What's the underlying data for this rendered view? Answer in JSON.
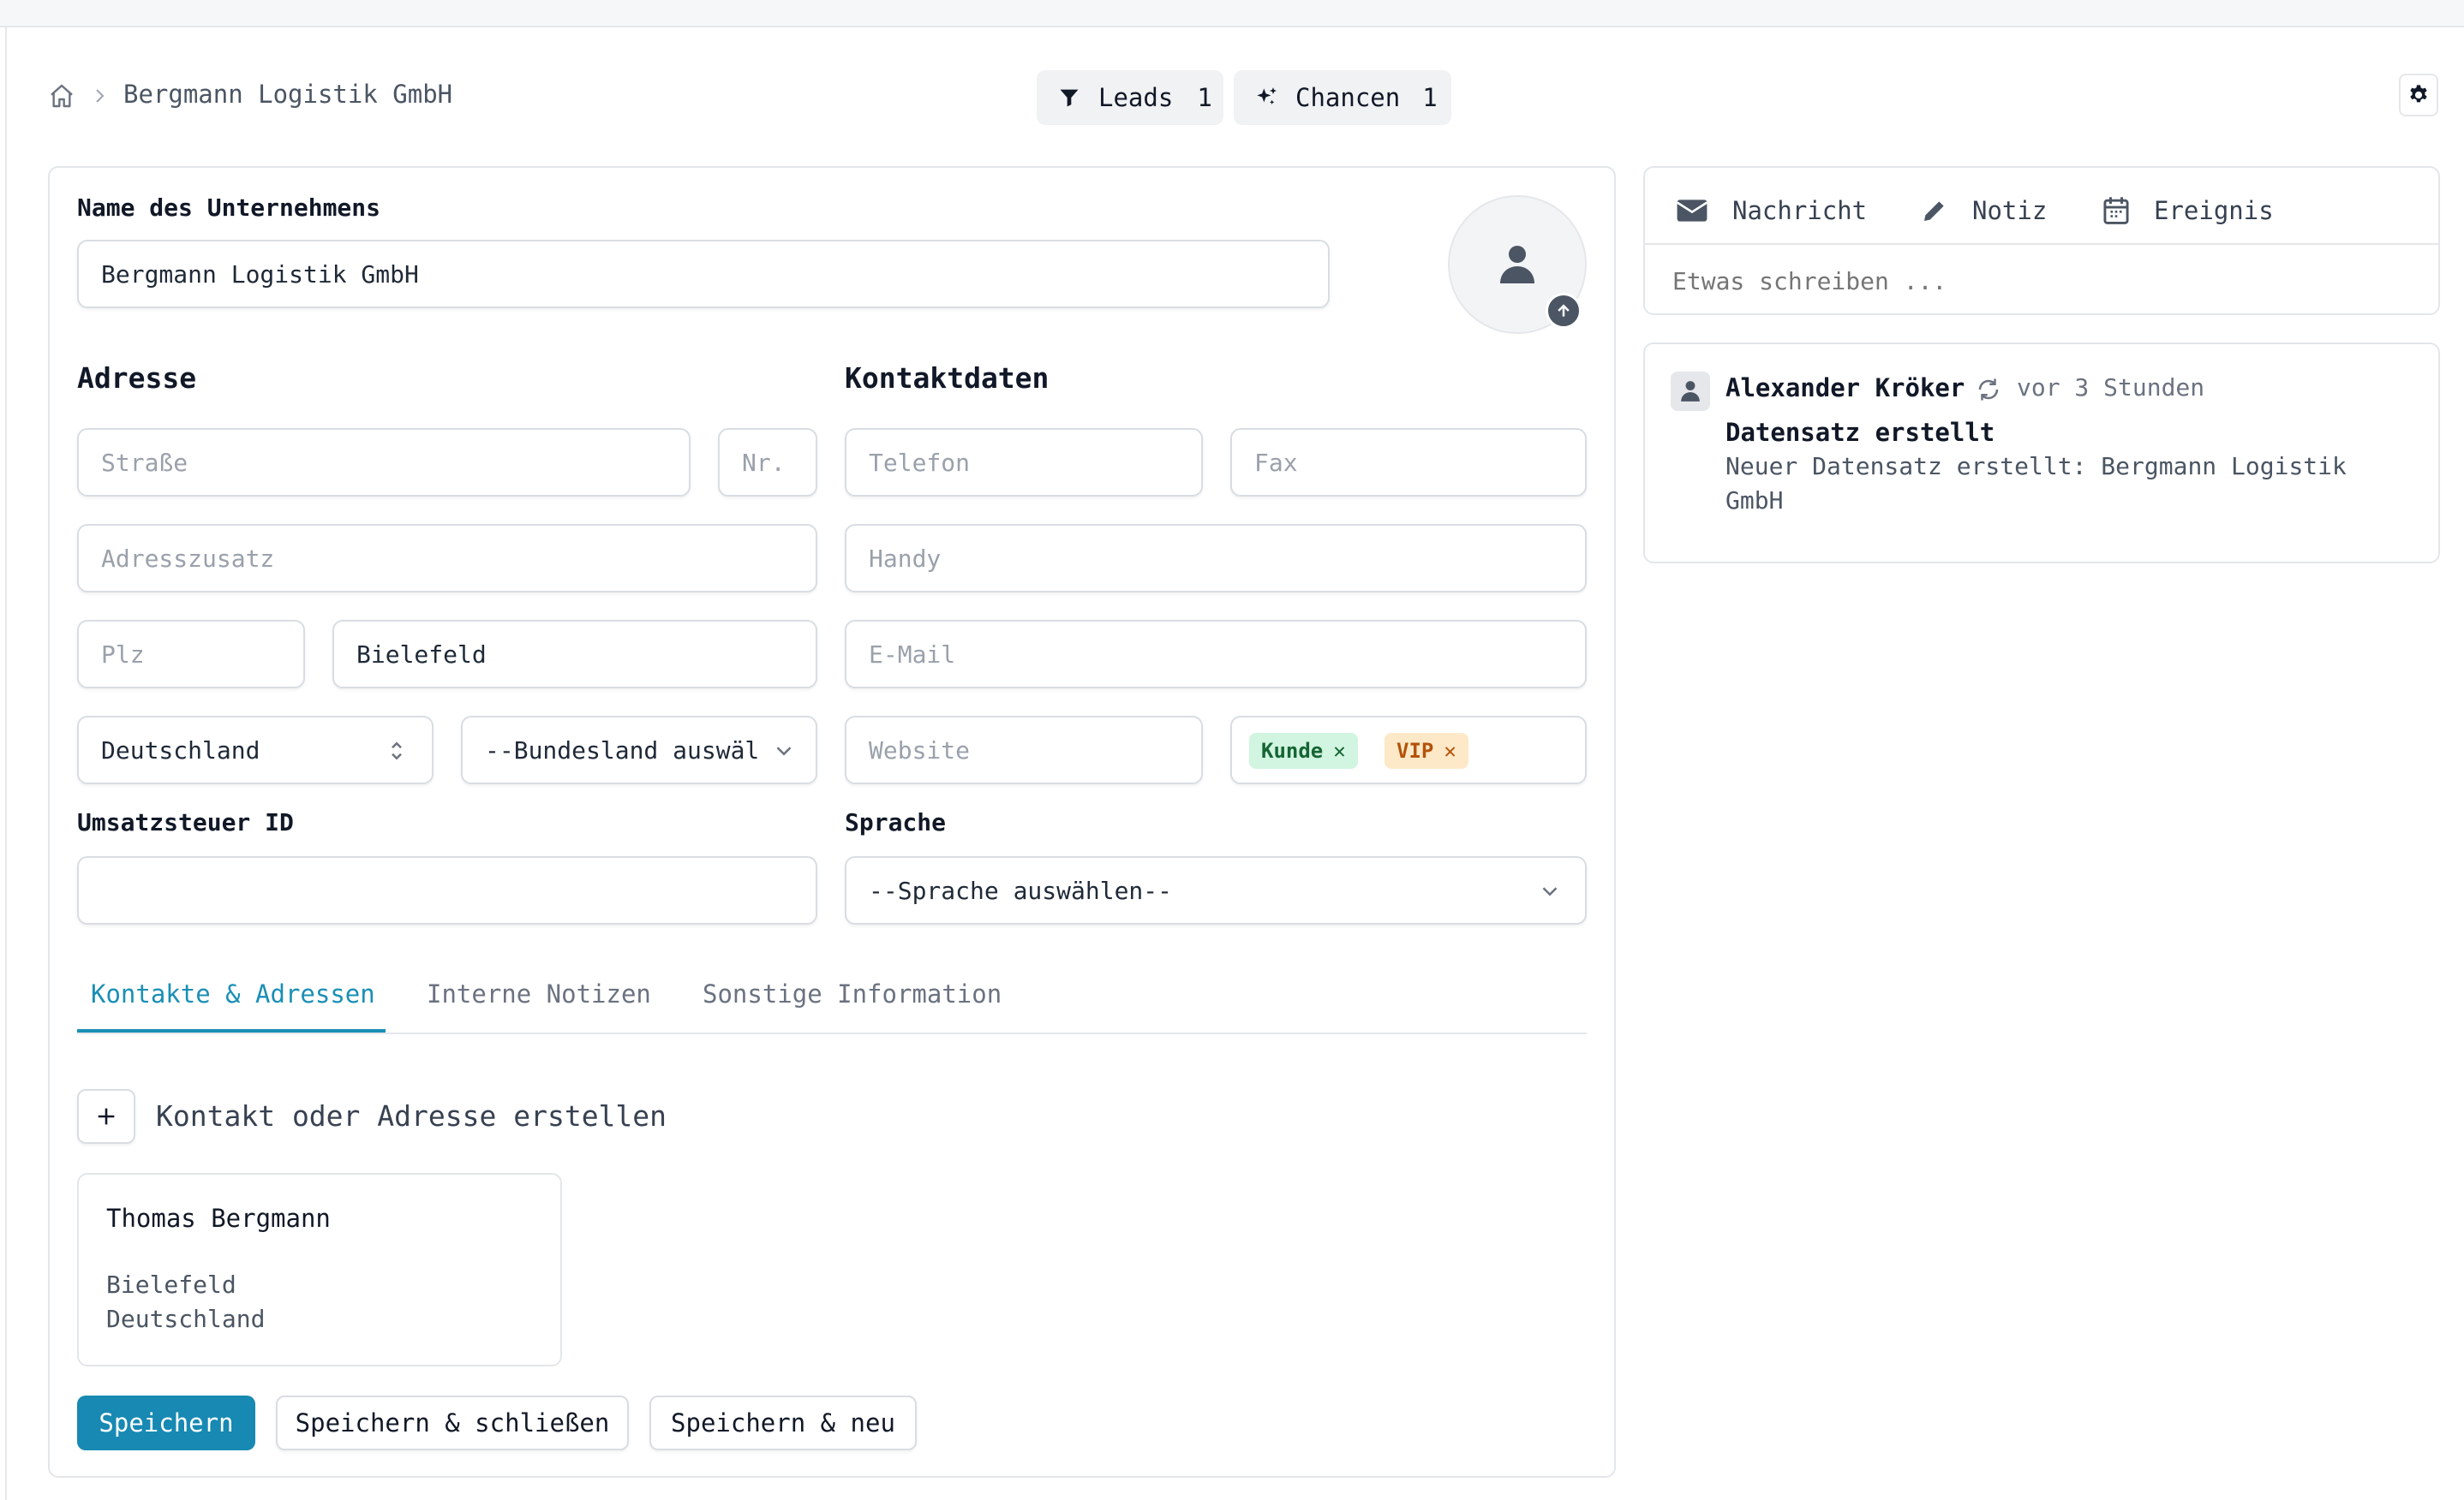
{
  "breadcrumb": {
    "current": "Bergmann Logistik GmbH"
  },
  "header_pills": [
    {
      "label": "Leads",
      "count": "1",
      "icon": "funnel-icon"
    },
    {
      "label": "Chancen",
      "count": "1",
      "icon": "sparkles-icon"
    }
  ],
  "form": {
    "company_label": "Name des Unternehmens",
    "company_value": "Bergmann Logistik GmbH",
    "address_heading": "Adresse",
    "contact_heading": "Kontaktdaten",
    "street_placeholder": "Straße",
    "number_placeholder": "Nr.",
    "address_extra_placeholder": "Adresszusatz",
    "zip_placeholder": "Plz",
    "city_value": "Bielefeld",
    "country_value": "Deutschland",
    "state_placeholder": "--Bundesland auswäl",
    "phone_placeholder": "Telefon",
    "fax_placeholder": "Fax",
    "mobile_placeholder": "Handy",
    "email_placeholder": "E-Mail",
    "website_placeholder": "Website",
    "tags": [
      {
        "label": "Kunde",
        "color": "#d1f5e0",
        "text_color": "#166534"
      },
      {
        "label": "VIP",
        "color": "#fde9c8",
        "text_color": "#b45309"
      }
    ],
    "vat_label": "Umsatzsteuer ID",
    "vat_value": "",
    "language_label": "Sprache",
    "language_placeholder": "--Sprache auswählen--"
  },
  "tabs": [
    {
      "label": "Kontakte & Adressen",
      "active": true
    },
    {
      "label": "Interne Notizen",
      "active": false
    },
    {
      "label": "Sonstige Information",
      "active": false
    }
  ],
  "create_contact_label": "Kontakt oder Adresse erstellen",
  "contact_card": {
    "name": "Thomas Bergmann",
    "city": "Bielefeld",
    "country": "Deutschland"
  },
  "buttons": {
    "save": "Speichern",
    "save_close": "Speichern & schließen",
    "save_new": "Speichern & neu"
  },
  "activity_tabs": [
    {
      "label": "Nachricht",
      "icon": "envelope-icon"
    },
    {
      "label": "Notiz",
      "icon": "pencil-icon"
    },
    {
      "label": "Ereignis",
      "icon": "calendar-icon"
    }
  ],
  "activity_placeholder": "Etwas schreiben ...",
  "activity_entry": {
    "user": "Alexander Kröker",
    "time": "vor 3 Stunden",
    "title": "Datensatz erstellt",
    "body_line1": "Neuer Datensatz erstellt: Bergmann Logistik",
    "body_line2": "GmbH"
  },
  "colors": {
    "accent": "#1a8fb5",
    "primary_button": "#1789b3"
  }
}
